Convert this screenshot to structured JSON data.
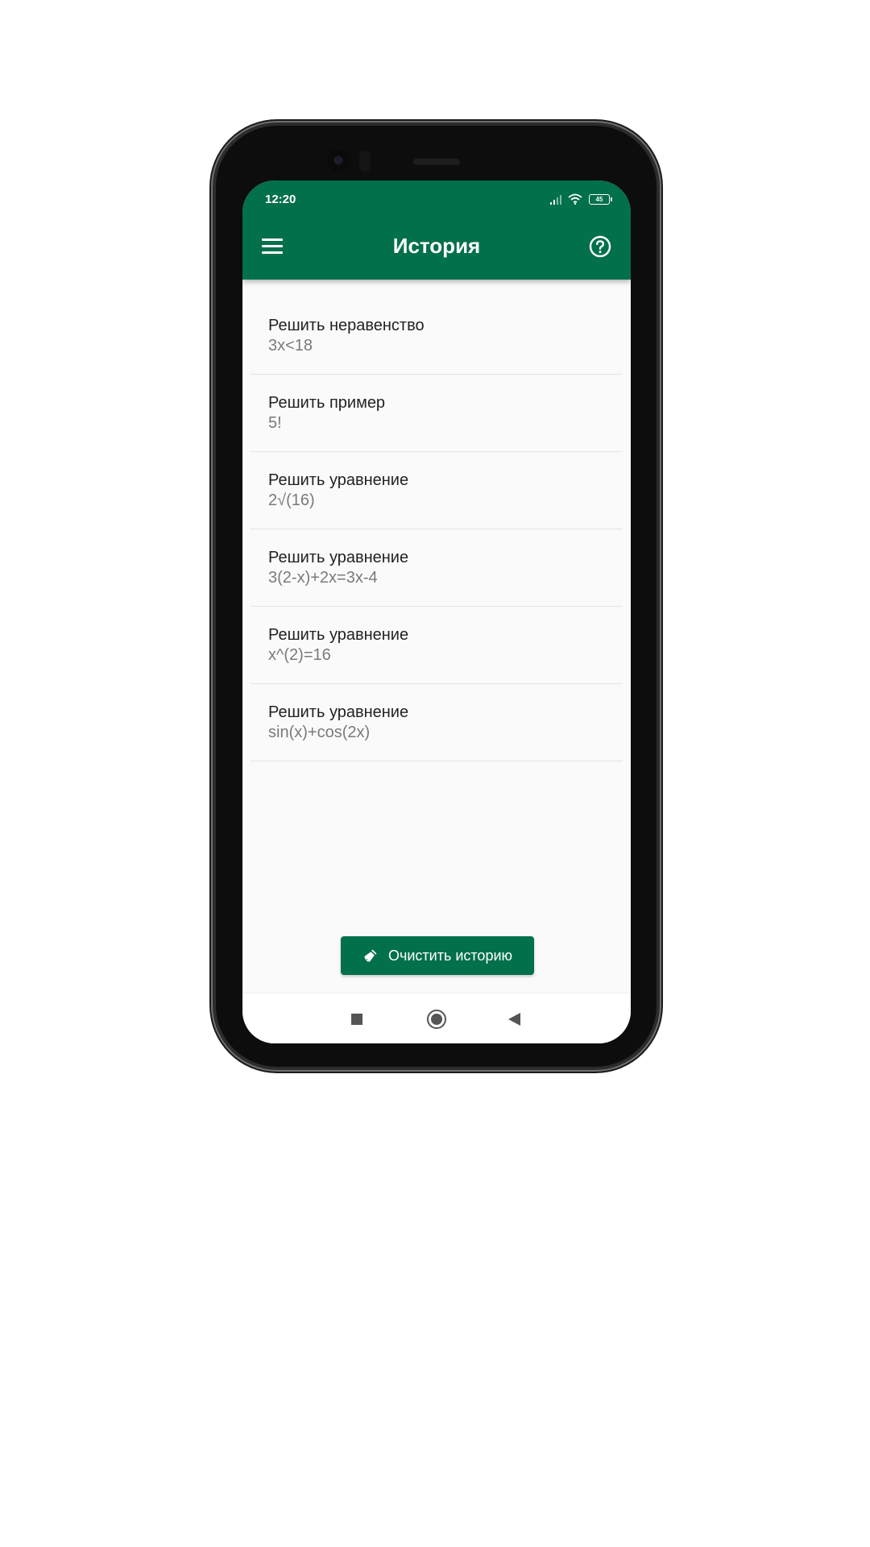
{
  "status_bar": {
    "time": "12:20",
    "battery": "45"
  },
  "app_bar": {
    "title": "История",
    "menu_icon": "hamburger-menu-icon",
    "help_icon": "help-circle-icon"
  },
  "history": [
    {
      "title": "Решить неравенство",
      "expression": "3x<18"
    },
    {
      "title": "Решить пример",
      "expression": "5!"
    },
    {
      "title": "Решить уравнение",
      "expression": "2√(16)"
    },
    {
      "title": "Решить уравнение",
      "expression": "3(2-x)+2x=3x-4"
    },
    {
      "title": "Решить уравнение",
      "expression": "x^(2)=16"
    },
    {
      "title": "Решить уравнение",
      "expression": "sin(x)+cos(2x)"
    }
  ],
  "clear_button": {
    "label": "Очистить историю",
    "icon": "broom-icon"
  },
  "colors": {
    "primary": "#02704a",
    "background": "#fafafa",
    "divider": "#e4e4e4"
  }
}
